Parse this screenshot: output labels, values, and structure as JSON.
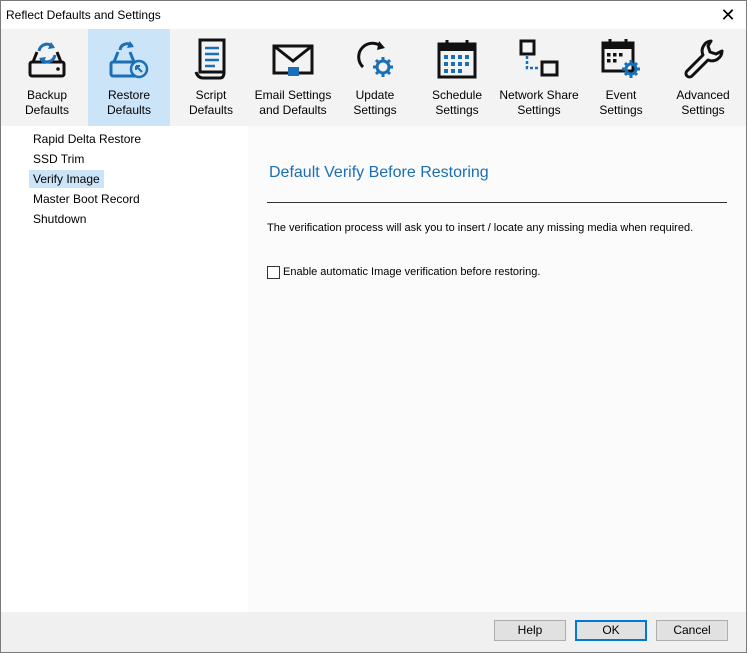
{
  "window": {
    "title": "Reflect Defaults and Settings",
    "close_glyph": "✕"
  },
  "toolbar": {
    "items": [
      {
        "label": "Backup\nDefaults",
        "icon": "backup-drive-icon"
      },
      {
        "label": "Restore\nDefaults",
        "icon": "restore-drive-icon",
        "active": true
      },
      {
        "label": "Script\nDefaults",
        "icon": "script-icon"
      },
      {
        "label": "Email Settings\nand Defaults",
        "icon": "email-icon"
      },
      {
        "label": "Update\nSettings",
        "icon": "update-gear-icon"
      },
      {
        "label": "Schedule\nSettings",
        "icon": "calendar-icon"
      },
      {
        "label": "Network Share\nSettings",
        "icon": "network-icon"
      },
      {
        "label": "Event\nSettings",
        "icon": "event-calendar-gear-icon"
      },
      {
        "label": "Advanced\nSettings",
        "icon": "wrench-icon"
      }
    ]
  },
  "sidebar": {
    "items": [
      {
        "label": "Rapid Delta Restore"
      },
      {
        "label": "SSD Trim"
      },
      {
        "label": "Verify Image",
        "selected": true
      },
      {
        "label": "Master Boot Record"
      },
      {
        "label": "Shutdown"
      }
    ]
  },
  "content": {
    "heading": "Default Verify Before Restoring",
    "description": "The verification process will ask you to insert / locate any missing media when required.",
    "checkbox": {
      "label": "Enable automatic Image verification before restoring.",
      "checked": false
    }
  },
  "footer": {
    "help": "Help",
    "ok": "OK",
    "cancel": "Cancel"
  },
  "colors": {
    "accent": "#0078d7",
    "heading": "#1a6fb7",
    "selection": "#cce4f7"
  }
}
